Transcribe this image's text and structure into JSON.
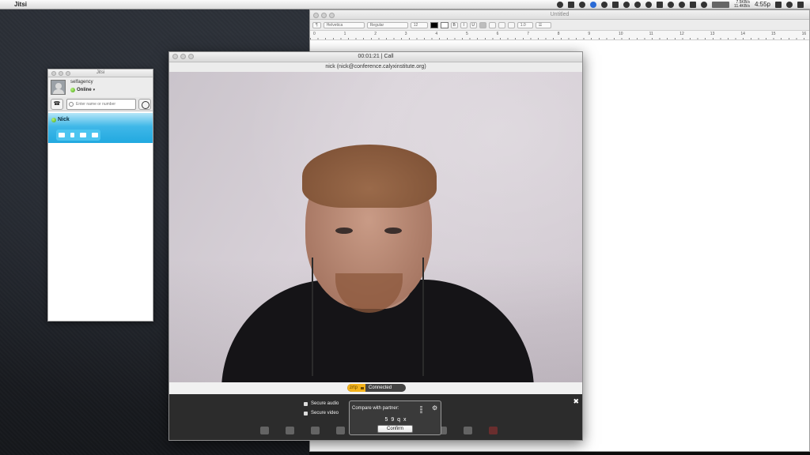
{
  "menubar": {
    "app_name": "Jitsi",
    "net_up": "7.5KB/s",
    "net_down": "11.4KB/s",
    "clock": "4:55p"
  },
  "textedit": {
    "title": "Untitled",
    "font_family": "Helvetica",
    "font_style": "Regular",
    "font_size": "12",
    "bold": "B",
    "italic": "I",
    "underline": "U",
    "line_spacing": "1.0",
    "ruler_numbers": [
      "0",
      "1",
      "2",
      "3",
      "4",
      "5",
      "6",
      "7",
      "8",
      "9",
      "10",
      "11",
      "12",
      "13",
      "14",
      "15",
      "16"
    ]
  },
  "jitsi": {
    "title": "Jitsi",
    "account_name": "selfagency",
    "status": "Online",
    "search_placeholder": "Enter name or number",
    "contact_name": "Nick"
  },
  "call": {
    "title": "00:01:21 | Call",
    "peer": "nick (nick@conference.calyxinstitute.org)",
    "zrtp_label": "zrtp",
    "connection_status": "Connected",
    "secure_audio": "Secure audio",
    "secure_video": "Secure video",
    "compare_label": "Compare with partner:",
    "sas_code": "5 9 q x",
    "confirm_label": "Confirm",
    "close_label": "✖"
  }
}
